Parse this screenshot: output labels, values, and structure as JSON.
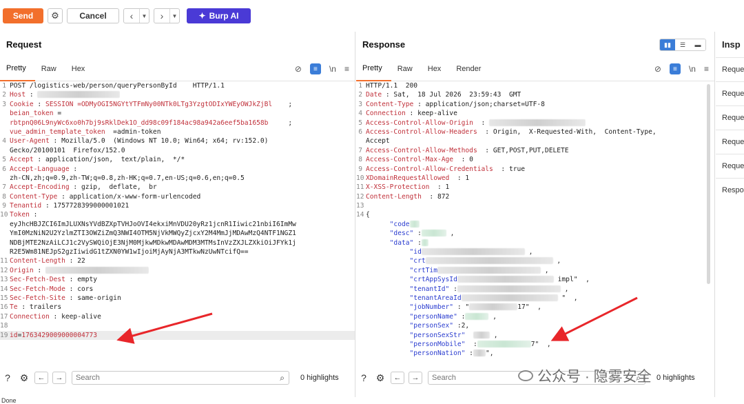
{
  "toolbar": {
    "send_label": "Send",
    "cancel_label": "Cancel",
    "burp_ai_label": "Burp AI"
  },
  "request": {
    "title": "Request",
    "tabs": [
      "Pretty",
      "Raw",
      "Hex"
    ],
    "lines": [
      {
        "n": "1",
        "parts": [
          [
            "",
            "POST /logistics-web/person/queryPersonById    HTTP/1.1"
          ]
        ]
      },
      {
        "n": "2",
        "parts": [
          [
            "k",
            "Host"
          ],
          [
            "",
            " : "
          ]
        ],
        "blur": 120
      },
      {
        "n": "3",
        "parts": [
          [
            "k",
            "Cookie"
          ],
          [
            "",
            " : "
          ],
          [
            "red",
            "SESSION =ODMyOGI5NGYtYTFmNy00NTk0LTg3YzgtODIxYWEyOWJkZjBl"
          ],
          [
            "",
            "    ;"
          ]
        ]
      },
      {
        "n": "",
        "parts": [
          [
            "red",
            "beian_token"
          ],
          [
            "",
            " ="
          ]
        ]
      },
      {
        "n": "",
        "parts": [
          [
            "red",
            "rbtpnQ06L9nyWc6xo0h7bj9sRklDek1O_dd98c09f184ac98a942a6eef5ba1658b"
          ],
          [
            "",
            "     ;"
          ]
        ]
      },
      {
        "n": "",
        "parts": [
          [
            "red",
            "vue_admin_template_token"
          ],
          [
            "",
            "  =admin-token"
          ]
        ]
      },
      {
        "n": "4",
        "parts": [
          [
            "k",
            "User-Agent"
          ],
          [
            "",
            " : Mozilla/5.0  (Windows NT 10.0; Win64; x64; rv:152.0)"
          ]
        ]
      },
      {
        "n": "",
        "parts": [
          [
            "",
            "Gecko/20100101  Firefox/152.0"
          ]
        ]
      },
      {
        "n": "5",
        "parts": [
          [
            "k",
            "Accept"
          ],
          [
            "",
            " : application/json,  text/plain,  */*"
          ]
        ]
      },
      {
        "n": "6",
        "parts": [
          [
            "k",
            "Accept-Language"
          ],
          [
            "",
            " :"
          ]
        ]
      },
      {
        "n": "",
        "parts": [
          [
            "",
            "zh-CN,zh;q=0.9,zh-TW;q=0.8,zh-HK;q=0.7,en-US;q=0.6,en;q=0.5"
          ]
        ]
      },
      {
        "n": "7",
        "parts": [
          [
            "k",
            "Accept-Encoding"
          ],
          [
            "",
            " : gzip,  deflate,  br"
          ]
        ]
      },
      {
        "n": "8",
        "parts": [
          [
            "k",
            "Content-Type"
          ],
          [
            "",
            " : application/x-www-form-urlencoded"
          ]
        ]
      },
      {
        "n": "9",
        "parts": [
          [
            "k",
            "Tenantid"
          ],
          [
            "",
            " : 1757728399000001021"
          ]
        ]
      },
      {
        "n": "10",
        "parts": [
          [
            "k",
            "Token"
          ],
          [
            "",
            " :"
          ]
        ]
      },
      {
        "n": "",
        "parts": [
          [
            "",
            "eyJhcHBJZCI6ImJLUXNsYVdBZXpTVHJoOVI4ekxiMnVDU20yRz1jcnR1Iiwic21nbiI6ImMw"
          ]
        ]
      },
      {
        "n": "",
        "parts": [
          [
            "",
            "YmI0MzNiN2U2YzlmZTI3OWZiZmQ3NWI4OTM5NjVkMWQyZjcxY2M4MmJjMDAwMzQ4NTF1NGZ1"
          ]
        ]
      },
      {
        "n": "",
        "parts": [
          [
            "",
            "NDBjMTE2NzAiLCJ1c2VySWQiOjE3NjM0MjkwMDkwMDAwMDM3MTMsInVzZXJLZXkiOiJFYk1j"
          ]
        ]
      },
      {
        "n": "",
        "parts": [
          [
            "",
            "R2E5Wm81NEJpS2gzIiwidG1tZXN0YW1wIjoiMjAyNjA3MTkwNzUwNTcifQ=="
          ]
        ]
      },
      {
        "n": "11",
        "parts": [
          [
            "k",
            "Content-Length"
          ],
          [
            "",
            " : 22"
          ]
        ]
      },
      {
        "n": "12",
        "parts": [
          [
            "k",
            "Origin"
          ],
          [
            "",
            " : "
          ]
        ],
        "blur": 150
      },
      {
        "n": "13",
        "parts": [
          [
            "k",
            "Sec-Fetch-Dest"
          ],
          [
            "",
            " : empty"
          ]
        ]
      },
      {
        "n": "14",
        "parts": [
          [
            "k",
            "Sec-Fetch-Mode"
          ],
          [
            "",
            " : cors"
          ]
        ]
      },
      {
        "n": "15",
        "parts": [
          [
            "k",
            "Sec-Fetch-Site"
          ],
          [
            "",
            " : same-origin"
          ]
        ]
      },
      {
        "n": "16",
        "parts": [
          [
            "k",
            "Te"
          ],
          [
            "",
            " : trailers"
          ]
        ]
      },
      {
        "n": "17",
        "parts": [
          [
            "k",
            "Connection"
          ],
          [
            "",
            " : keep-alive"
          ]
        ]
      },
      {
        "n": "18",
        "parts": [
          [
            "",
            ""
          ]
        ]
      },
      {
        "n": "19",
        "parts": [
          [
            "red",
            "id"
          ],
          [
            "",
            "="
          ],
          [
            "red",
            "1763429009000004773"
          ]
        ],
        "highlight": true
      }
    ],
    "search_placeholder": "Search",
    "highlights": "0 highlights"
  },
  "response": {
    "title": "Response",
    "tabs": [
      "Pretty",
      "Raw",
      "Hex",
      "Render"
    ],
    "lines": [
      {
        "n": "1",
        "parts": [
          [
            "",
            "HTTP/1.1  200"
          ]
        ]
      },
      {
        "n": "2",
        "parts": [
          [
            "k",
            "Date"
          ],
          [
            "",
            " : Sat,  18 Jul 2026  23:59:43  GMT"
          ]
        ]
      },
      {
        "n": "3",
        "parts": [
          [
            "k",
            "Content-Type"
          ],
          [
            "",
            " : application/json;charset=UTF-8"
          ]
        ]
      },
      {
        "n": "4",
        "parts": [
          [
            "k",
            "Connection"
          ],
          [
            "",
            " : keep-alive"
          ]
        ]
      },
      {
        "n": "5",
        "parts": [
          [
            "k",
            "Access-Control-Allow-Origin"
          ],
          [
            "",
            "  : "
          ]
        ],
        "blur": 140
      },
      {
        "n": "6",
        "parts": [
          [
            "k",
            "Access-Control-Allow-Headers"
          ],
          [
            "",
            "  : Origin,  X-Requested-With,  Content-Type,"
          ]
        ]
      },
      {
        "n": "",
        "parts": [
          [
            "",
            "Accept"
          ]
        ]
      },
      {
        "n": "7",
        "parts": [
          [
            "k",
            "Access-Control-Allow-Methods"
          ],
          [
            "",
            "  : GET,POST,PUT,DELETE"
          ]
        ]
      },
      {
        "n": "8",
        "parts": [
          [
            "k",
            "Access-Control-Max-Age"
          ],
          [
            "",
            "  : 0"
          ]
        ]
      },
      {
        "n": "9",
        "parts": [
          [
            "k",
            "Access-Control-Allow-Credentials"
          ],
          [
            "",
            "  : true"
          ]
        ]
      },
      {
        "n": "10",
        "parts": [
          [
            "k",
            "XDomainRequestAllowed"
          ],
          [
            "",
            "  : 1"
          ]
        ]
      },
      {
        "n": "11",
        "parts": [
          [
            "k",
            "X-XSS-Protection"
          ],
          [
            "",
            "  : 1"
          ]
        ]
      },
      {
        "n": "12",
        "parts": [
          [
            "k",
            "Content-Length"
          ],
          [
            "",
            "  : 872"
          ]
        ]
      },
      {
        "n": "13",
        "parts": [
          [
            "",
            ""
          ]
        ]
      },
      {
        "n": "14",
        "parts": [
          [
            "",
            "{"
          ]
        ]
      },
      {
        "n": "",
        "parts": [
          [
            "blue",
            "      \"code"
          ]
        ],
        "blurg": 14
      },
      {
        "n": "",
        "parts": [
          [
            "blue",
            "      \"desc\""
          ],
          [
            "",
            " :"
          ]
        ],
        "blurg": 36,
        "tail": " ,"
      },
      {
        "n": "",
        "parts": [
          [
            "blue",
            "      \"data\""
          ],
          [
            "",
            " :"
          ]
        ],
        "blurg": 10
      },
      {
        "n": "",
        "parts": [
          [
            "blue",
            "           \"id"
          ]
        ],
        "blur": 150,
        "tail": " ,"
      },
      {
        "n": "",
        "parts": [
          [
            "blue",
            "           \"crt"
          ]
        ],
        "blur": 185,
        "tail": " ,"
      },
      {
        "n": "",
        "parts": [
          [
            "blue",
            "           \"crtTim"
          ]
        ],
        "blur": 150,
        "tail": " ,"
      },
      {
        "n": "",
        "parts": [
          [
            "blue",
            "           \"crtAppSysId"
          ]
        ],
        "blur": 140,
        "tail": " impl\"  ,"
      },
      {
        "n": "",
        "parts": [
          [
            "blue",
            "           \"tenantId\""
          ],
          [
            "",
            " :"
          ]
        ],
        "blur": 150,
        "tail": " ,"
      },
      {
        "n": "",
        "parts": [
          [
            "blue",
            "           \"tenantAreaId"
          ]
        ],
        "blur": 140,
        "tail": " \"  ,"
      },
      {
        "n": "",
        "parts": [
          [
            "blue",
            "           \"jobNumber\""
          ],
          [
            "",
            " : \""
          ]
        ],
        "blur": 70,
        "tail": "17\"  ,"
      },
      {
        "n": "",
        "parts": [
          [
            "blue",
            "           \"personName\""
          ],
          [
            "",
            " :"
          ]
        ],
        "blurg": 34,
        "tail": " ,"
      },
      {
        "n": "",
        "parts": [
          [
            "blue",
            "           \"personSex\""
          ],
          [
            "",
            " :2,"
          ]
        ]
      },
      {
        "n": "",
        "parts": [
          [
            "blue",
            "           \"personSexStr\""
          ],
          [
            "",
            "  "
          ]
        ],
        "blur": 24,
        "tail": " ,"
      },
      {
        "n": "",
        "parts": [
          [
            "blue",
            "           \"personMobile\""
          ],
          [
            "",
            "  :"
          ]
        ],
        "blurg": 78,
        "tail": "7\"  ,"
      },
      {
        "n": "",
        "parts": [
          [
            "blue",
            "           \"personNation\""
          ],
          [
            "",
            " :"
          ]
        ],
        "blur": 18,
        "tail": "\","
      }
    ],
    "search_placeholder": "Search",
    "highlights": "0 highlights"
  },
  "inspector": {
    "title": "Insp",
    "items": [
      "Reque",
      "Reque",
      "Reque",
      "Reque",
      "Reque",
      "Respo"
    ]
  },
  "statusbar": {
    "text": "Done"
  },
  "watermark": {
    "text": "公众号 · 隐雾安全"
  }
}
